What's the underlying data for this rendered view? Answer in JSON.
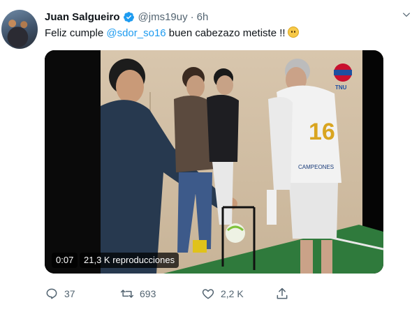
{
  "tweet": {
    "author_name": "Juan Salgueiro",
    "handle": "@jms19uy",
    "separator": "·",
    "time": "6h",
    "text_before": "Feliz cumple ",
    "mention": "@sdor_so16",
    "text_after": " buen cabezazo metiste !!",
    "emoji": "slightly-frowning-face"
  },
  "media": {
    "timestamp": "0:07",
    "views": "21,3 K reproducciones",
    "channel_logo": "TNU",
    "jersey_number": "16",
    "jersey_sponsor": "CAMPEONES"
  },
  "actions": {
    "replies": "37",
    "retweets": "693",
    "likes": "2,2 K"
  },
  "colors": {
    "link": "#1d9bf0",
    "verified": "#1d9bf0",
    "secondary_text": "#536471"
  }
}
